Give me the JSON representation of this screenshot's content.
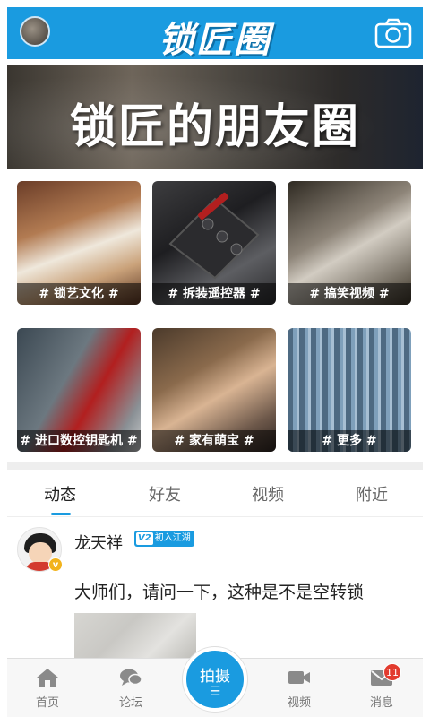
{
  "header": {
    "logo_text": "锁匠圈",
    "camera_icon": "camera-icon",
    "avatar": "user-avatar"
  },
  "banner": {
    "title": "锁匠的朋友圈"
  },
  "categories": [
    {
      "label": "# 锁艺文化 #"
    },
    {
      "label": "# 拆装遥控器 #"
    },
    {
      "label": "# 搞笑视频 #"
    },
    {
      "label": "# 进口数控钥匙机 #"
    },
    {
      "label": "# 家有萌宝 #"
    },
    {
      "label": "# 更多 #"
    }
  ],
  "tabs": [
    {
      "label": "动态",
      "active": true
    },
    {
      "label": "好友",
      "active": false
    },
    {
      "label": "视频",
      "active": false
    },
    {
      "label": "附近",
      "active": false
    }
  ],
  "post": {
    "username": "龙天祥",
    "verify_mark": "v",
    "level_prefix": "V2",
    "level_text": "初入江湖",
    "text": "大师们，请问一下，这种是不是空转锁"
  },
  "bottom_nav": {
    "items": [
      {
        "label": "首页",
        "icon": "home-icon"
      },
      {
        "label": "论坛",
        "icon": "chat-bubbles-icon"
      },
      {
        "label": "视频",
        "icon": "video-camera-icon"
      },
      {
        "label": "消息",
        "icon": "envelope-icon"
      }
    ],
    "shoot_label": "拍摄",
    "shoot_mark": "☰",
    "message_count": "11"
  },
  "colors": {
    "accent": "#1a9be0",
    "badge_red": "#e23b2e",
    "verify_gold": "#f2b31c"
  }
}
